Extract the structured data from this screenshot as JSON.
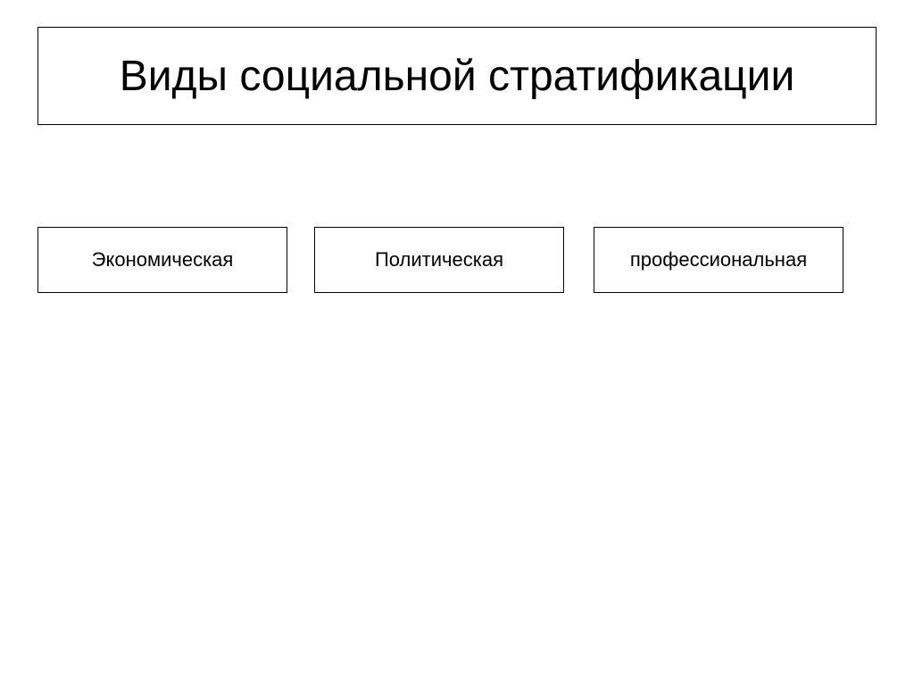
{
  "title": "Виды социальной стратификации",
  "items": [
    "Экономическая",
    "Политическая",
    "профессиональная"
  ]
}
